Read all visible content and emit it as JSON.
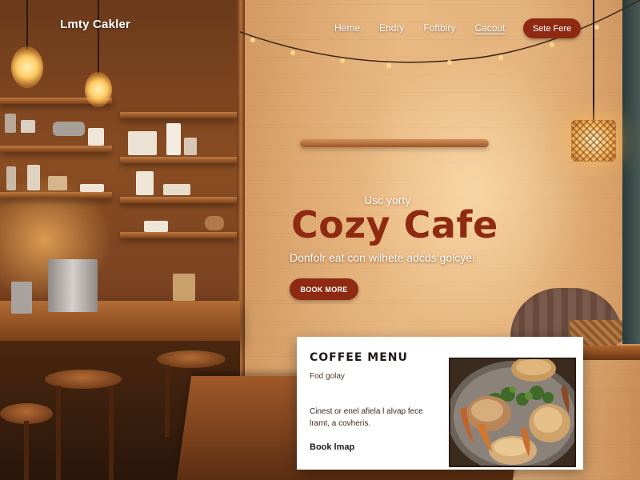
{
  "brand": {
    "name": "Lmty Cakler"
  },
  "nav": {
    "links": [
      "Heme",
      "Endry",
      "Foftbiry",
      "Cacout"
    ],
    "active_index": 3,
    "cta_label": "Sete Fere"
  },
  "hero": {
    "kicker": "Usc yorty",
    "title": "Cozy Cafe",
    "tagline": "Donfolr eat con wilhete adcds golcye!",
    "cta_label": "BOOK MORE"
  },
  "menu_card": {
    "title": "COFFEE MENU",
    "subtitle": "Fod golay",
    "description": "Cinest or enel afiela l alvap fece lramt, a covheris.",
    "link_label": "Book lmap",
    "image_icon": "food-plate-image"
  },
  "colors": {
    "accent": "#8e2a12",
    "card_bg": "#ffffff",
    "nav_text": "#ffffff"
  }
}
